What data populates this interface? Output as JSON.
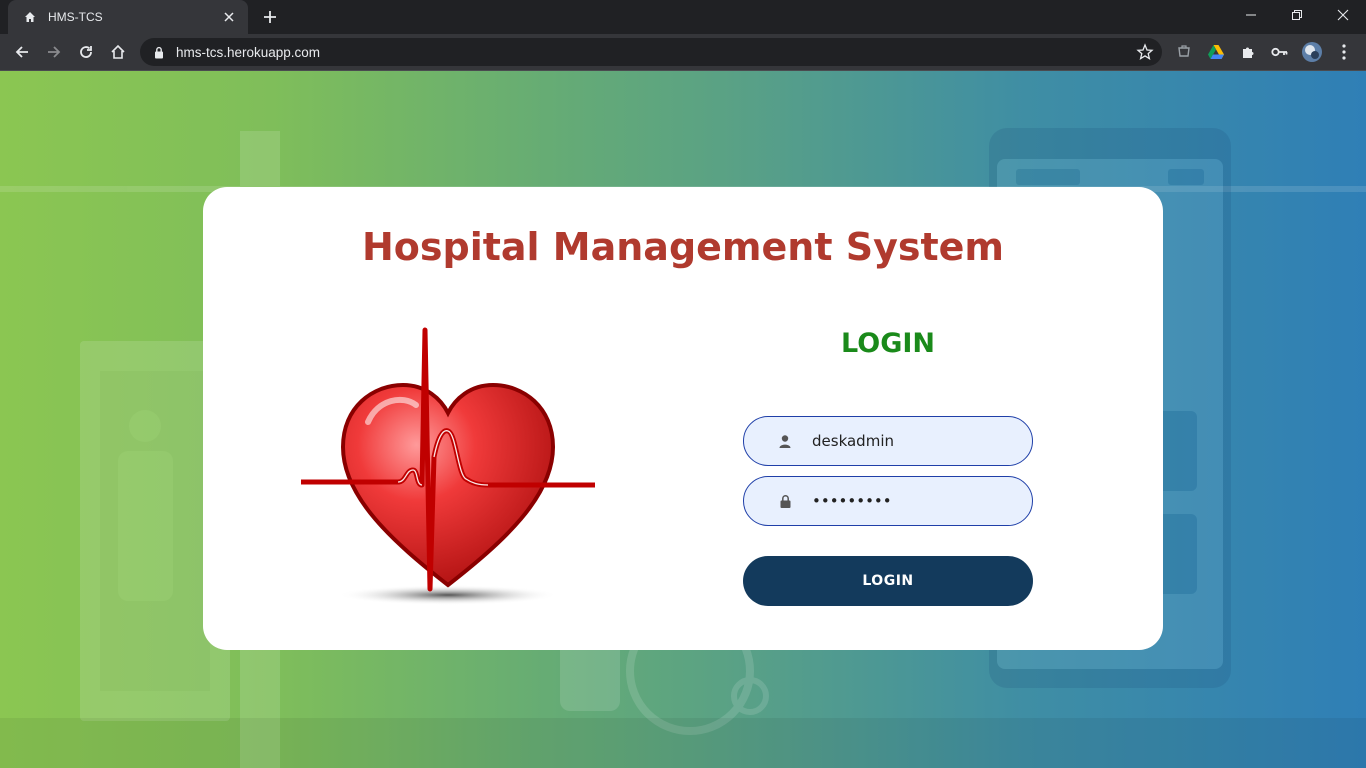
{
  "browser": {
    "tab_title": "HMS-TCS",
    "url": "hms-tcs.herokuapp.com"
  },
  "icons": {
    "tab_favicon": "home-icon",
    "tab_close": "close-icon",
    "new_tab": "plus-icon",
    "minimize": "minimize-icon",
    "restore": "restore-icon",
    "close_window": "close-icon",
    "back": "arrow-left-icon",
    "forward": "arrow-right-icon",
    "reload": "reload-icon",
    "home": "home-icon",
    "lock": "lock-icon",
    "bookmark": "star-icon",
    "extensions": [
      "extension-icon",
      "drive-icon",
      "puzzle-icon",
      "key-icon",
      "profile-avatar",
      "more-vertical-icon"
    ],
    "user_field": "user-icon",
    "password_field": "lock-icon"
  },
  "page": {
    "title": "Hospital Management System",
    "login_heading": "LOGIN",
    "username_value": "deskadmin",
    "password_value": "•••••••••",
    "login_button": "LOGIN"
  },
  "colors": {
    "title": "#b03a2e",
    "login_heading": "#1a8a1a",
    "button_bg": "#133a5c",
    "field_bg": "#e8f0fe",
    "field_border": "#1f3fa8",
    "bg_gradient_start": "#8bc652",
    "bg_gradient_end": "#2f7fb6"
  }
}
